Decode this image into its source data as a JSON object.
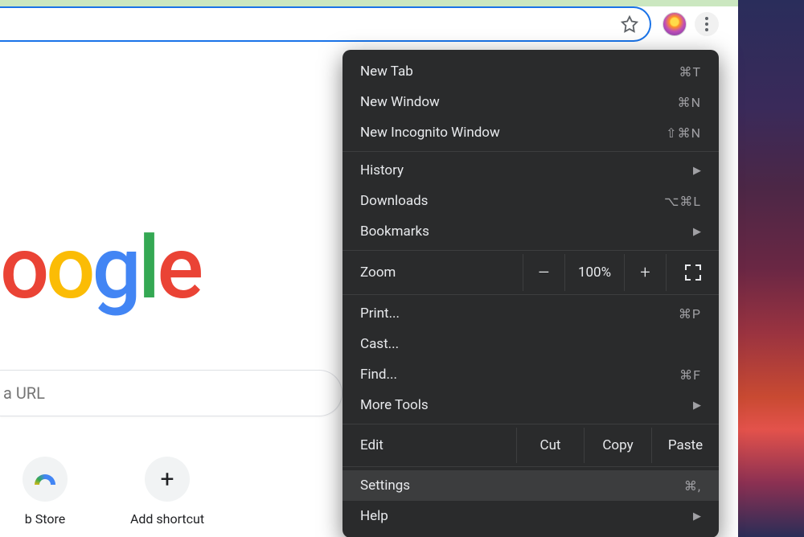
{
  "search_placeholder": "a URL",
  "shortcuts": {
    "store_label": "b Store",
    "add_label": "Add shortcut"
  },
  "menu": {
    "new_tab": {
      "label": "New Tab",
      "key": "⌘T"
    },
    "new_window": {
      "label": "New Window",
      "key": "⌘N"
    },
    "incognito": {
      "label": "New Incognito Window",
      "key": "⇧⌘N"
    },
    "history": {
      "label": "History"
    },
    "downloads": {
      "label": "Downloads",
      "key": "⌥⌘L"
    },
    "bookmarks": {
      "label": "Bookmarks"
    },
    "zoom": {
      "label": "Zoom",
      "value": "100%",
      "minus": "–",
      "plus": "+"
    },
    "print": {
      "label": "Print...",
      "key": "⌘P"
    },
    "cast": {
      "label": "Cast..."
    },
    "find": {
      "label": "Find...",
      "key": "⌘F"
    },
    "more_tools": {
      "label": "More Tools"
    },
    "edit": {
      "label": "Edit",
      "cut": "Cut",
      "copy": "Copy",
      "paste": "Paste"
    },
    "settings": {
      "label": "Settings",
      "key": "⌘,"
    },
    "help": {
      "label": "Help"
    }
  }
}
